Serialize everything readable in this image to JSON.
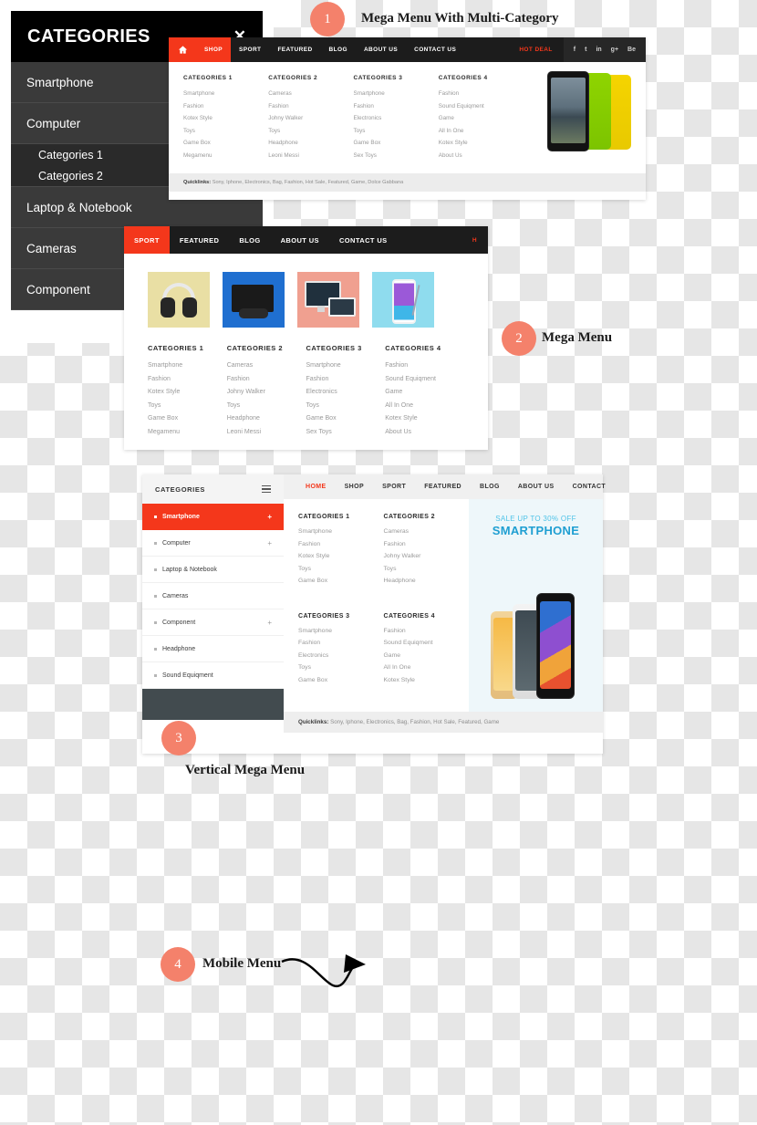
{
  "annotations": [
    {
      "num": "1",
      "label": "Mega Menu With Multi-Category"
    },
    {
      "num": "2",
      "label": "Mega Menu"
    },
    {
      "num": "3",
      "label": "Vertical Mega Menu"
    },
    {
      "num": "4",
      "label": "Mobile Menu"
    }
  ],
  "colors": {
    "accent_red": "#f4371b",
    "badge": "#f4816b",
    "dark_nav": "#1c1c1c",
    "promo_blue": "#1f9fd2"
  },
  "panel1": {
    "nav": {
      "home_icon": "home-icon",
      "items": [
        "SHOP",
        "SPORT",
        "FEATURED",
        "BLOG",
        "ABOUT US",
        "CONTACT US"
      ],
      "active": "SHOP",
      "hot_deal": "HOT DEAL",
      "socials": [
        "f",
        "t",
        "in",
        "g+",
        "Be"
      ]
    },
    "columns": [
      {
        "title": "CATEGORIES 1",
        "links": [
          "Smartphone",
          "Fashion",
          "Kotex Style",
          "Toys",
          "Game Box",
          "Megamenu"
        ]
      },
      {
        "title": "CATEGORIES 2",
        "links": [
          "Cameras",
          "Fashion",
          "Johny Walker",
          "Toys",
          "Headphone",
          "Leoni Messi"
        ]
      },
      {
        "title": "CATEGORIES 3",
        "links": [
          "Smartphone",
          "Fashion",
          "Electronics",
          "Toys",
          "Game Box",
          "Sex Toys"
        ]
      },
      {
        "title": "CATEGORIES 4",
        "links": [
          "Fashion",
          "Sound Equiqment",
          "Game",
          "All In One",
          "Kotex Style",
          "About Us"
        ]
      }
    ],
    "quicklinks_label": "Quicklinks:",
    "quicklinks_text": " Sony, Iphone, Electronics, Bag, Fashion, Hot Sale, Featured, Game, Dolce Gabbana"
  },
  "panel2": {
    "nav": {
      "items": [
        "SPORT",
        "FEATURED",
        "BLOG",
        "ABOUT US",
        "CONTACT US"
      ],
      "active": "SPORT",
      "hot_deal": "H"
    },
    "thumbs": [
      "headphone-thumb",
      "console-thumb",
      "desktop-thumb",
      "smartphone-thumb"
    ],
    "columns": [
      {
        "title": "CATEGORIES 1",
        "links": [
          "Smartphone",
          "Fashion",
          "Kotex Style",
          "Toys",
          "Game Box",
          "Megamenu"
        ]
      },
      {
        "title": "CATEGORIES 2",
        "links": [
          "Cameras",
          "Fashion",
          "Johny Walker",
          "Toys",
          "Headphone",
          "Leoni Messi"
        ]
      },
      {
        "title": "CATEGORIES 3",
        "links": [
          "Smartphone",
          "Fashion",
          "Electronics",
          "Toys",
          "Game Box",
          "Sex Toys"
        ]
      },
      {
        "title": "CATEGORIES 4",
        "links": [
          "Fashion",
          "Sound Equiqment",
          "Game",
          "All In One",
          "Kotex Style",
          "About Us"
        ]
      }
    ]
  },
  "panel3": {
    "categories_title": "CATEGORIES",
    "vertical_items": [
      {
        "label": "Smartphone",
        "plus": "+",
        "active": true
      },
      {
        "label": "Computer",
        "plus": "+",
        "active": false
      },
      {
        "label": "Laptop & Notebook",
        "plus": "",
        "active": false
      },
      {
        "label": "Cameras",
        "plus": "",
        "active": false
      },
      {
        "label": "Component",
        "plus": "+",
        "active": false
      },
      {
        "label": "Headphone",
        "plus": "",
        "active": false
      },
      {
        "label": "Sound Equiqment",
        "plus": "",
        "active": false
      }
    ],
    "nav": {
      "items": [
        "HOME",
        "SHOP",
        "SPORT",
        "FEATURED",
        "BLOG",
        "ABOUT US",
        "CONTACT"
      ],
      "active": "HOME"
    },
    "columns": [
      {
        "title": "CATEGORIES 1",
        "links": [
          "Smartphone",
          "Fashion",
          "Kotex Style",
          "Toys",
          "Game Box"
        ]
      },
      {
        "title": "CATEGORIES 2",
        "links": [
          "Cameras",
          "Fashion",
          "Johny Walker",
          "Toys",
          "Headphone"
        ]
      },
      {
        "title": "CATEGORIES 3",
        "links": [
          "Smartphone",
          "Fashion",
          "Electronics",
          "Toys",
          "Game Box"
        ]
      },
      {
        "title": "CATEGORIES 4",
        "links": [
          "Fashion",
          "Sound Equiqment",
          "Game",
          "All In One",
          "Kotex Style"
        ]
      }
    ],
    "promo": {
      "line1": "SALE UP TO 30% OFF",
      "line2": "SMARTPHONE"
    },
    "quicklinks_label": "Quicklinks:",
    "quicklinks_text": " Sony, Iphone, Electronics, Bag, Fashion, Hot Sale, Featured, Game"
  },
  "panel4": {
    "title": "CATEGORIES",
    "close_icon": "close-icon",
    "rows": [
      {
        "label": "Smartphone",
        "toggle": "+",
        "type": "row"
      },
      {
        "label": "Computer",
        "toggle": "–",
        "type": "row"
      },
      {
        "label": "Categories 1",
        "toggle": "+",
        "type": "sub"
      },
      {
        "label": "Categories 2",
        "toggle": "+",
        "type": "sub"
      },
      {
        "label": "Laptop & Notebook",
        "toggle": "",
        "type": "row"
      },
      {
        "label": "Cameras",
        "toggle": "",
        "type": "row"
      },
      {
        "label": "Component",
        "toggle": "+",
        "type": "row"
      }
    ]
  }
}
